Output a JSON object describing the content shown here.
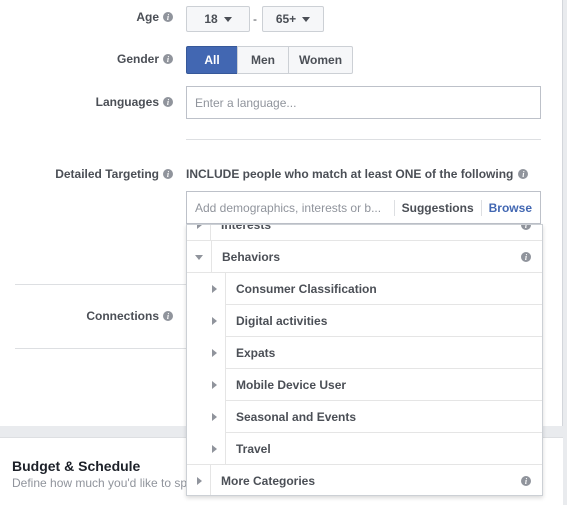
{
  "age": {
    "label": "Age",
    "min": "18",
    "separator": "-",
    "max": "65+"
  },
  "gender": {
    "label": "Gender",
    "options": [
      "All",
      "Men",
      "Women"
    ],
    "selected": "All"
  },
  "languages": {
    "label": "Languages",
    "placeholder": "Enter a language..."
  },
  "detailed_targeting": {
    "label": "Detailed Targeting",
    "include_text": "INCLUDE people who match at least ONE of the following",
    "placeholder": "Add demographics, interests or b...",
    "suggestions": "Suggestions",
    "browse": "Browse"
  },
  "dropdown": {
    "partial_item": "Interests",
    "behaviors": "Behaviors",
    "subitems": [
      "Consumer Classification",
      "Digital activities",
      "Expats",
      "Mobile Device User",
      "Seasonal and Events",
      "Travel"
    ],
    "more": "More Categories"
  },
  "connections": {
    "label": "Connections"
  },
  "budget": {
    "title": "Budget & Schedule",
    "description": "Define how much you'd like to sp"
  },
  "colors": {
    "accent": "#4267b2",
    "link": "#4267b2"
  }
}
